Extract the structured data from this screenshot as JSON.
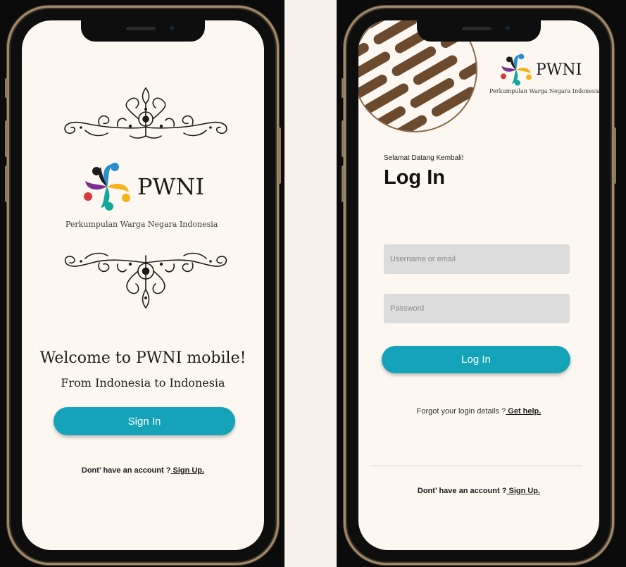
{
  "welcome_screen": {
    "brand": {
      "name": "PWNI",
      "tagline": "Perkumpulan Warga Negara Indonesia"
    },
    "welcome_title": "Welcome to PWNI mobile!",
    "welcome_subtitle": "From Indonesia to Indonesia",
    "sign_in_button": "Sign In",
    "signup_prompt": "Dont’ have an account ?",
    "signup_link": " Sign Up."
  },
  "login_screen": {
    "brand": {
      "name": "PWNI",
      "tagline": "Perkumpulan Warga Negara Indonesia"
    },
    "greeting": "Selamat Datang Kembali!",
    "title": "Log In",
    "username_placeholder": "Username or email",
    "password_placeholder": "Password",
    "login_button": "Log In",
    "forgot_prompt": "Forgot your login details ?",
    "forgot_link": " Get help.",
    "signup_prompt": "Dont’ have an account ?",
    "signup_link": " Sign Up."
  },
  "colors": {
    "accent": "#14a3b8",
    "screen_background": "#fcf7f1",
    "input_background": "#dcdcdc",
    "batik_brown": "#6b4a2e"
  }
}
